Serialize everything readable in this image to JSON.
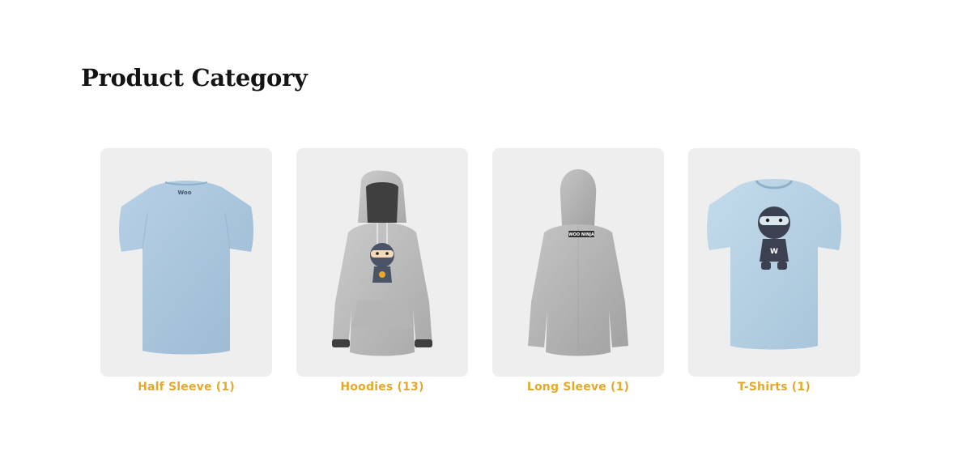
{
  "page_title": "Product Category",
  "categories": [
    {
      "label": "Half Sleeve (1)",
      "image_icon": "half-sleeve-tshirt-back-icon",
      "garment_color": "#a9c6dd"
    },
    {
      "label": "Hoodies (13)",
      "image_icon": "hoodie-ninja-front-icon",
      "garment_color": "#bcbcbc"
    },
    {
      "label": "Long Sleeve (1)",
      "image_icon": "hoodie-back-icon",
      "garment_color": "#b2b2b2"
    },
    {
      "label": "T-Shirts (1)",
      "image_icon": "tshirt-ninja-front-icon",
      "garment_color": "#b5d1e3"
    }
  ],
  "colors": {
    "label": "#e1a92d",
    "card_bg": "#eeeeee",
    "title": "#141414"
  },
  "logos": {
    "woo_small": "Woo",
    "woo_ninja": "WOO NINJA",
    "ninja_letter": "W"
  }
}
